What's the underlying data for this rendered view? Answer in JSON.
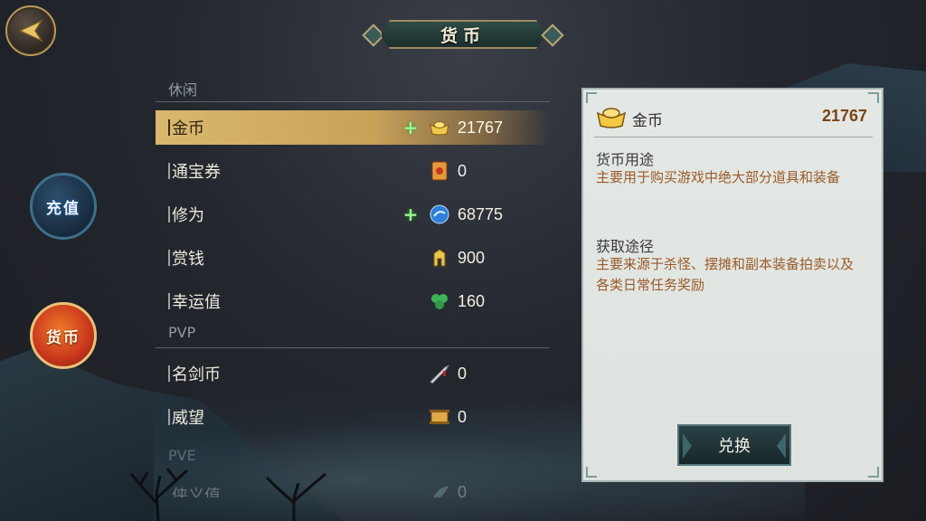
{
  "header": {
    "title": "货币"
  },
  "side_buttons": {
    "recharge": "充值",
    "currency": "货币"
  },
  "sections": {
    "casual": "休闲",
    "pvp": "PVP",
    "pve": "PVE"
  },
  "rows": [
    {
      "label": "金币",
      "value": "21767",
      "has_plus": true,
      "icon": "gold-ingot-icon",
      "selected": true
    },
    {
      "label": "通宝券",
      "value": "0",
      "has_plus": false,
      "icon": "scroll-ticket-icon"
    },
    {
      "label": "修为",
      "value": "68775",
      "has_plus": true,
      "icon": "blue-orb-icon"
    },
    {
      "label": "赏钱",
      "value": "900",
      "has_plus": false,
      "icon": "gold-coin-stack-icon"
    },
    {
      "label": "幸运值",
      "value": "160",
      "has_plus": false,
      "icon": "clover-icon"
    },
    {
      "label": "名剑币",
      "value": "0",
      "has_plus": false,
      "icon": "sword-icon"
    },
    {
      "label": "威望",
      "value": "0",
      "has_plus": false,
      "icon": "banner-scroll-icon"
    },
    {
      "label": "侠义值",
      "value": "0",
      "has_plus": false,
      "icon": "feather-icon"
    }
  ],
  "detail": {
    "name": "金币",
    "value": "21767",
    "usage_title": "货币用途",
    "usage_text": "主要用于购买游戏中绝大部分道具和装备",
    "source_title": "获取途径",
    "source_text_line1": "主要来源于杀怪、摆摊和副本装备拍卖以及",
    "source_text_line2": "各类日常任务奖励",
    "exchange_label": "兑换"
  },
  "colors": {
    "selected_row": "#d9b86f",
    "value_brown": "#7a4419",
    "plus_green": "#9ef29a"
  }
}
